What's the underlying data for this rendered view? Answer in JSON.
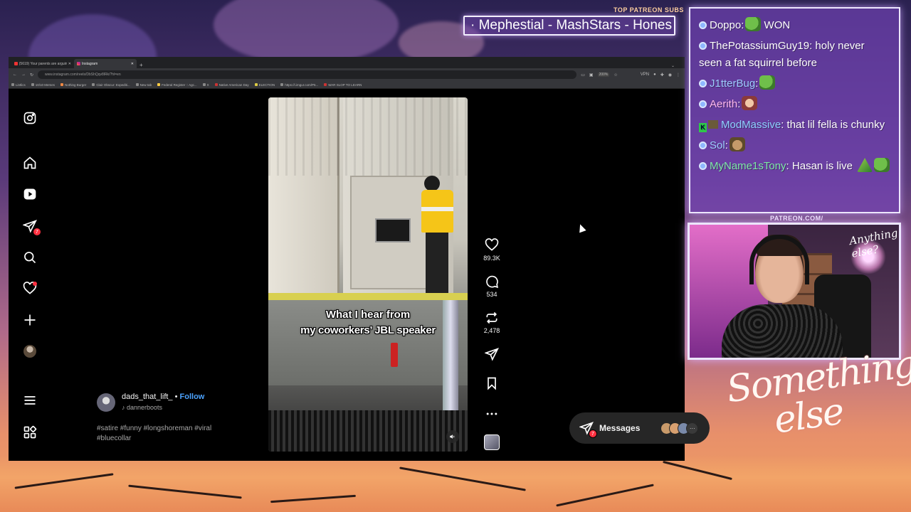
{
  "overlay": {
    "patreon_label": "TOP PATREON SUBS",
    "ticker_text": "· Mephestial - MashStars - Hones",
    "patreon_url": "PATREON.COM/",
    "cam_sticker": "Anything else?",
    "signature_line1": "Something",
    "signature_line2": "else"
  },
  "browser": {
    "tabs": [
      {
        "label": "(5619) Your parents are arguing",
        "active": false
      },
      {
        "label": "Instagram",
        "active": true
      }
    ],
    "new_tab": "+",
    "url": "www.instagram.com/reels/DbShQqv8lRk/?hl=en",
    "zoom": "200%",
    "vpn": "VPN",
    "bookmarks": [
      "Lintlics",
      "10/10 Memes",
      "Nothing Burger",
      "Clair Obscur: Expediti...",
      "New tab",
      "Federal Register :: Agc...",
      "X",
      "Native American Day",
      "ELECTION",
      "https://i.imgur.com/P5...",
      "WAR SLOP TO LEARN"
    ]
  },
  "instagram": {
    "nav": {
      "instagram": "instagram-logo-icon",
      "home": "home-icon",
      "reels": "reels-icon",
      "messages_badge": "7",
      "search": "search-icon",
      "notifications": "heart-icon",
      "create": "plus-icon",
      "more": "menu-icon",
      "threads": "apps-icon"
    },
    "reel": {
      "caption_line1": "What I hear from",
      "caption_line2": "my coworkers’ JBL speaker"
    },
    "actions": {
      "likes": "89.3K",
      "comments": "534",
      "reposts": "2,478"
    },
    "author": {
      "username": "dads_that_lift_",
      "separator": " • ",
      "follow": "Follow",
      "subtitle": "dannerboots",
      "tags": "#satire #funny #longshoreman #viral #bluecollar"
    },
    "messages": {
      "label": "Messages",
      "badge": "7",
      "more": "···"
    }
  },
  "chat": [
    {
      "user": "Doppo",
      "color": "#ffffff",
      "message": "WON",
      "emote": "pepe"
    },
    {
      "user": "ThePotassiumGuy19",
      "color": "#ffffff",
      "message": "holy never seen a fat squirrel before",
      "emote": ""
    },
    {
      "user": "J1tterBug",
      "color": "#9ecbff",
      "message": "",
      "emote": "pepe"
    },
    {
      "user": "Aerith",
      "color": "#ffb8ee",
      "message": "",
      "emote": "girl"
    },
    {
      "user": "ModMassive",
      "color": "#8ed0ff",
      "message": "that lil fella is chunky",
      "emote": "",
      "mod": true
    },
    {
      "user": "Sol",
      "color": "#9ecbff",
      "message": "",
      "emote": "pepe2"
    },
    {
      "user": "MyName1sTony",
      "color": "#7ee8a8",
      "message": "Hasan is live",
      "emote": "hat-pepe"
    }
  ]
}
